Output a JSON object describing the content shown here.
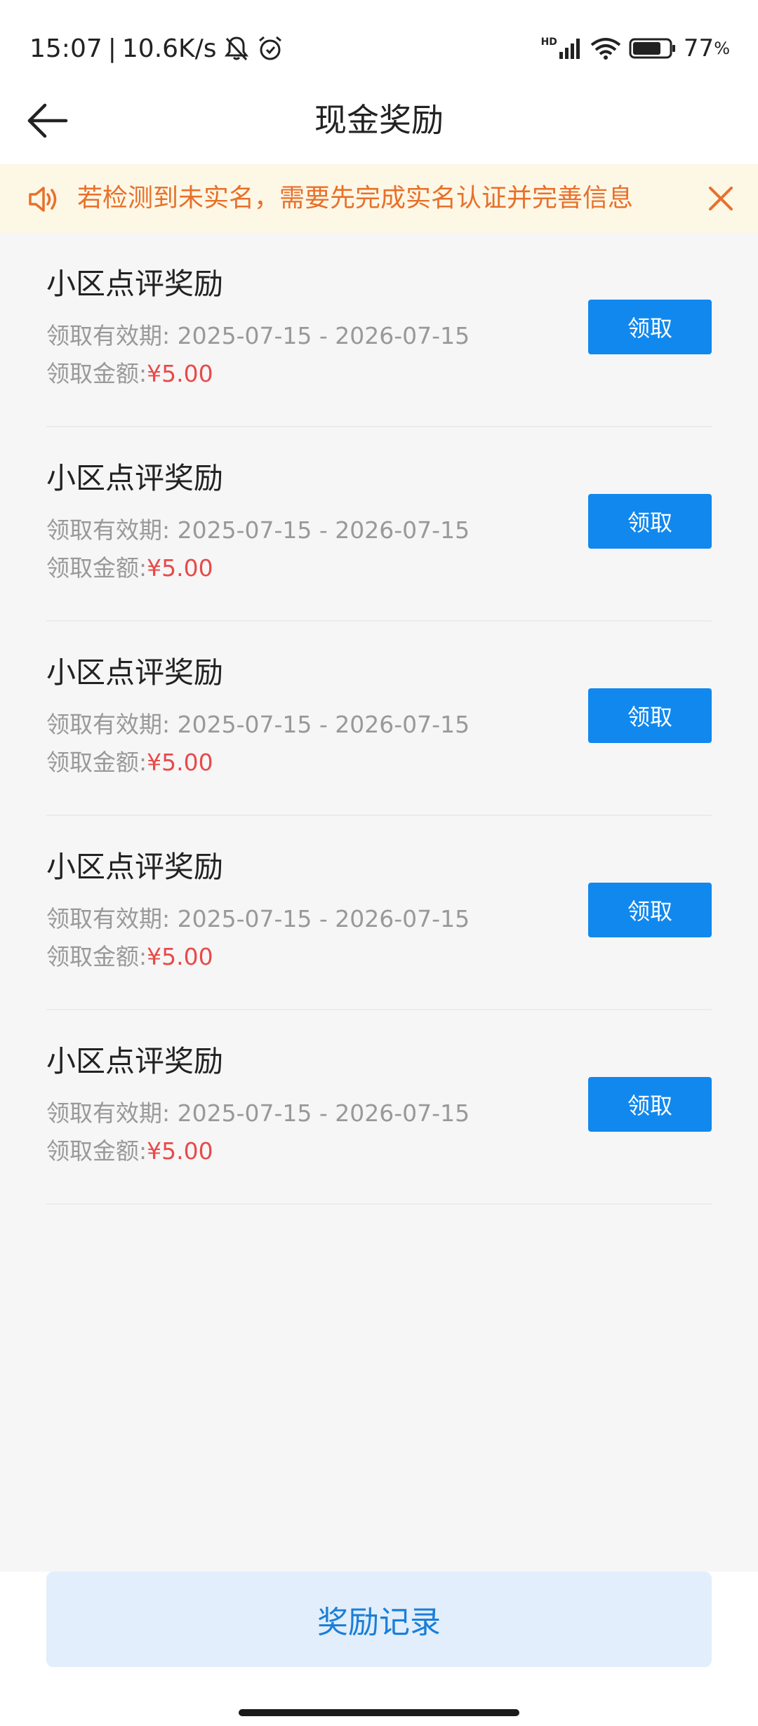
{
  "status_bar": {
    "time": "15:07",
    "separator": "|",
    "speed": "10.6K/s",
    "hd_label": "HD",
    "battery_percent": "77",
    "battery_unit": "%",
    "battery_level": 0.77
  },
  "header": {
    "title": "现金奖励"
  },
  "notice": {
    "text": "若检测到未实名，需要先完成实名认证并完善信息",
    "color": "#e8702a",
    "background": "#fdf7e6"
  },
  "rewards": [
    {
      "title": "小区点评奖励",
      "period_label": "领取有效期:",
      "period": "2025-07-15 - 2026-07-15",
      "amount_label": "领取金额:",
      "amount": "¥5.00",
      "button": "领取"
    },
    {
      "title": "小区点评奖励",
      "period_label": "领取有效期:",
      "period": "2025-07-15 - 2026-07-15",
      "amount_label": "领取金额:",
      "amount": "¥5.00",
      "button": "领取"
    },
    {
      "title": "小区点评奖励",
      "period_label": "领取有效期:",
      "period": "2025-07-15 - 2026-07-15",
      "amount_label": "领取金额:",
      "amount": "¥5.00",
      "button": "领取"
    },
    {
      "title": "小区点评奖励",
      "period_label": "领取有效期:",
      "period": "2025-07-15 - 2026-07-15",
      "amount_label": "领取金额:",
      "amount": "¥5.00",
      "button": "领取"
    },
    {
      "title": "小区点评奖励",
      "period_label": "领取有效期:",
      "period": "2025-07-15 - 2026-07-15",
      "amount_label": "领取金额:",
      "amount": "¥5.00",
      "button": "领取"
    }
  ],
  "bottom": {
    "records_label": "奖励记录"
  },
  "colors": {
    "accent": "#1188ee",
    "amount": "#e84a4a",
    "page_bg": "#f6f6f6"
  },
  "icons": {
    "status": [
      "bell-off-icon",
      "alarm-icon",
      "signal-icon",
      "wifi-icon",
      "battery-icon"
    ],
    "header": "back-arrow-icon",
    "notice_left": "speaker-icon",
    "notice_right": "close-icon"
  }
}
